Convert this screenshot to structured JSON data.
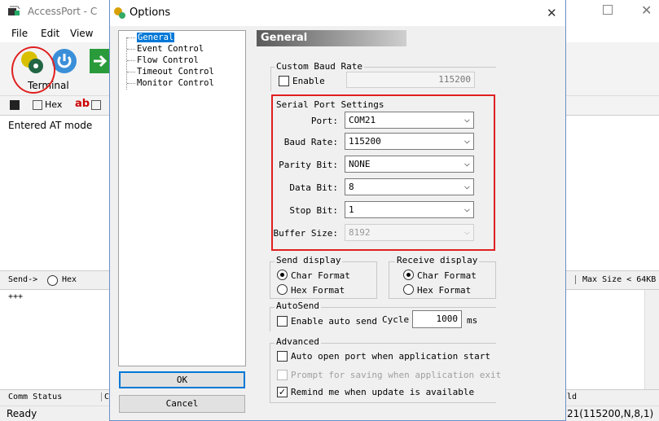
{
  "app": {
    "title": "AccessPort - C",
    "menu": [
      "File",
      "Edit",
      "View"
    ],
    "toolbar_tab": "Terminal",
    "toolbar2": {
      "hex": "Hex",
      "ab": "ab"
    },
    "received_text": "Entered AT mode",
    "send_label": "Send->",
    "send_hex": "Hex",
    "max_size": "Max Size < 64KB",
    "send_text": "+++",
    "comm_status": "Comm Status",
    "comm_partial": "C",
    "right_partial_ld": "ld",
    "status_left": "Ready",
    "status_right": "21(115200,N,8,1)"
  },
  "dialog": {
    "title": "Options",
    "tree": [
      "General",
      "Event Control",
      "Flow Control",
      "Timeout Control",
      "Monitor Control"
    ],
    "ok": "OK",
    "cancel": "Cancel",
    "panel_title": "General",
    "custom_baud": {
      "label": "Custom Baud Rate",
      "enable": "Enable",
      "value": "115200"
    },
    "serial": {
      "label": "Serial Port Settings",
      "port_label": "Port:",
      "port": "COM21",
      "baud_label": "Baud Rate:",
      "baud": "115200",
      "parity_label": "Parity Bit:",
      "parity": "NONE",
      "data_label": "Data Bit:",
      "data": "8",
      "stop_label": "Stop Bit:",
      "stop": "1",
      "buffer_label": "Buffer Size:",
      "buffer": "8192"
    },
    "send_display": {
      "label": "Send display",
      "char": "Char Format",
      "hex": "Hex  Format"
    },
    "recv_display": {
      "label": "Receive display",
      "char": "Char Format",
      "hex": "Hex  Format"
    },
    "autosend": {
      "label": "AutoSend",
      "enable": "Enable auto send",
      "cycle_label": "Cycle",
      "cycle": "1000",
      "unit": "ms"
    },
    "advanced": {
      "label": "Advanced",
      "auto_open": "Auto open port when application start",
      "prompt_save": "Prompt for saving when application exit",
      "remind": "Remind me when update is available"
    }
  },
  "colors": {
    "highlight": "#e02020",
    "selection": "#0078d7"
  }
}
